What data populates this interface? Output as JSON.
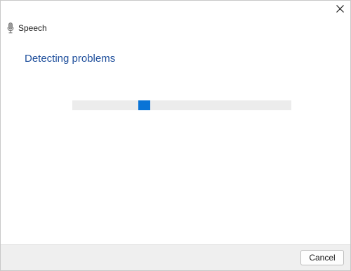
{
  "window": {
    "title": "Speech",
    "close_icon": "close-icon",
    "title_icon": "microphone-icon"
  },
  "main": {
    "heading": "Detecting problems",
    "progress": {
      "indeterminate": true,
      "accent_color": "#0a74d6",
      "track_color": "#ececec",
      "chunk_position_fraction": 0.3
    }
  },
  "footer": {
    "cancel_label": "Cancel"
  },
  "colors": {
    "heading": "#1f4f9c",
    "footer_bg": "#efefef"
  }
}
